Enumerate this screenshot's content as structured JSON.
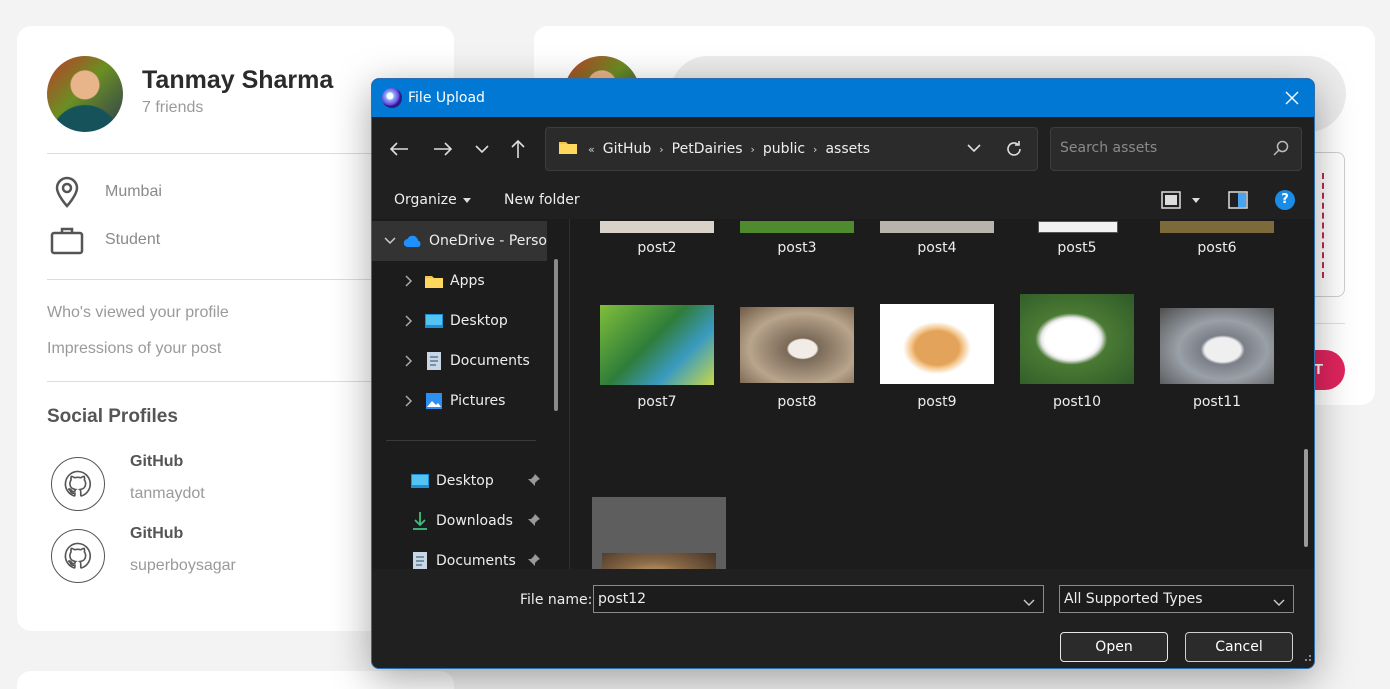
{
  "profile": {
    "name": "Tanmay Sharma",
    "friends": "7 friends",
    "location": "Mumbai",
    "occupation": "Student",
    "viewed_link": "Who's viewed your profile",
    "impressions_link": "Impressions of your post",
    "social_title": "Social Profiles",
    "socials": [
      {
        "platform": "GitHub",
        "handle": "tanmaydot",
        "icon": "github-icon"
      },
      {
        "platform": "GitHub",
        "handle": "superboysagar",
        "icon": "github-icon"
      }
    ]
  },
  "composer": {
    "post_button_partial": "T"
  },
  "dialog": {
    "title": "File Upload",
    "breadcrumb_overflow": "«",
    "breadcrumbs": [
      "GitHub",
      "PetDairies",
      "public",
      "assets"
    ],
    "search_placeholder": "Search assets",
    "organize_label": "Organize",
    "new_folder_label": "New folder",
    "help_label": "?",
    "nav": [
      {
        "label": "OneDrive - Perso",
        "icon": "onedrive-icon",
        "expandable": true,
        "expanded": true,
        "selected": true
      },
      {
        "label": "Apps",
        "icon": "folder-icon",
        "expandable": true
      },
      {
        "label": "Desktop",
        "icon": "desktop-icon",
        "expandable": true
      },
      {
        "label": "Documents",
        "icon": "documents-icon",
        "expandable": true
      },
      {
        "label": "Pictures",
        "icon": "pictures-icon",
        "expandable": true
      },
      {
        "label": "Desktop",
        "icon": "desktop-icon",
        "pinned": true
      },
      {
        "label": "Downloads",
        "icon": "download-icon",
        "pinned": true
      },
      {
        "label": "Documents",
        "icon": "documents-icon",
        "pinned": true
      }
    ],
    "files": [
      {
        "name": "post2",
        "color": "#d8d2c8"
      },
      {
        "name": "post3",
        "color": "#4f8a2e"
      },
      {
        "name": "post4",
        "color": "#b8b3ad"
      },
      {
        "name": "post5",
        "color": "#f2f2f2"
      },
      {
        "name": "post6",
        "color": "#7c6a3a"
      },
      {
        "name": "post7",
        "color": "#5a9a2a"
      },
      {
        "name": "post8",
        "color": "#9a8a78"
      },
      {
        "name": "post9",
        "color": "#ffffff"
      },
      {
        "name": "post10",
        "color": "#3e6e2e"
      },
      {
        "name": "post11",
        "color": "#6f6f6f"
      },
      {
        "name": "post12",
        "color": "#8a6a48",
        "selected": true
      }
    ],
    "file_name_label": "File name:",
    "file_name_value": "post12",
    "file_type": "All Supported Types",
    "open_label": "Open",
    "cancel_label": "Cancel"
  }
}
